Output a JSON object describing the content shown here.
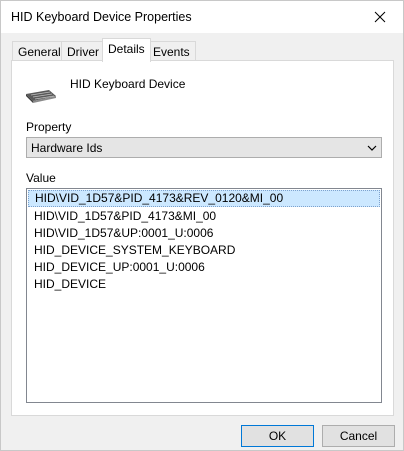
{
  "window": {
    "title": "HID Keyboard Device Properties"
  },
  "tabs": [
    {
      "label": "General"
    },
    {
      "label": "Driver"
    },
    {
      "label": "Details",
      "active": true
    },
    {
      "label": "Events"
    }
  ],
  "device": {
    "name": "HID Keyboard Device",
    "icon": "keyboard-icon"
  },
  "property": {
    "label": "Property",
    "selected": "Hardware Ids"
  },
  "value": {
    "label": "Value",
    "items": [
      "HID\\VID_1D57&PID_4173&REV_0120&MI_00",
      "HID\\VID_1D57&PID_4173&MI_00",
      "HID\\VID_1D57&UP:0001_U:0006",
      "HID_DEVICE_SYSTEM_KEYBOARD",
      "HID_DEVICE_UP:0001_U:0006",
      "HID_DEVICE"
    ],
    "selected_index": 0
  },
  "buttons": {
    "ok": "OK",
    "cancel": "Cancel"
  },
  "colors": {
    "selection": "#cce8ff",
    "default_button_border": "#0078d7"
  }
}
